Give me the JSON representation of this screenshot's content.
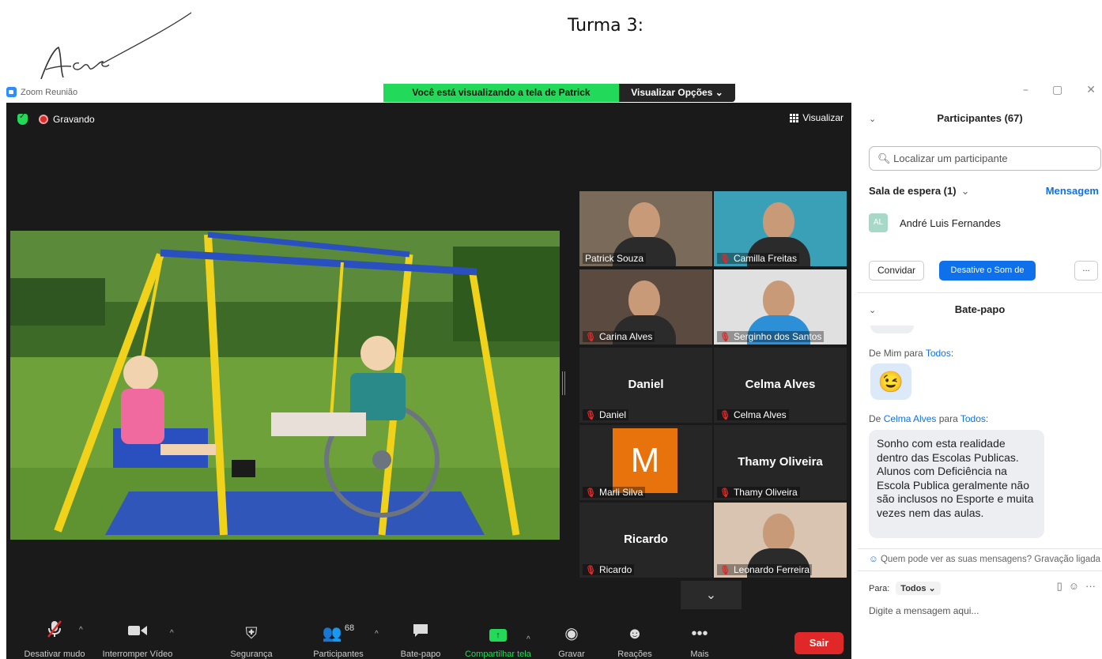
{
  "document": {
    "title": "Turma 3:"
  },
  "window": {
    "title": "Zoom Reunião",
    "share_banner": "Você está visualizando a tela de Patrick Souza",
    "view_options": "Visualizar Opções ⌄",
    "controls": [
      "–",
      "▢",
      "✕"
    ]
  },
  "meeting": {
    "recording_label": "Gravando",
    "view_label": "Visualizar",
    "gallery": [
      {
        "name": "Patrick Souza",
        "muted": false,
        "has_video": true,
        "active": true
      },
      {
        "name": "Camilla Freitas",
        "muted": true,
        "has_video": true
      },
      {
        "name": "Carina Alves",
        "muted": true,
        "has_video": true
      },
      {
        "name": "Serginho dos Santos",
        "muted": true,
        "has_video": true
      },
      {
        "name": "Daniel",
        "muted": true,
        "has_video": false
      },
      {
        "name": "Celma Alves",
        "muted": true,
        "has_video": false
      },
      {
        "name": "Marli Silva",
        "muted": true,
        "has_video": false,
        "avatar_letter": "M"
      },
      {
        "name": "Thamy Oliveira",
        "muted": true,
        "has_video": false
      },
      {
        "name": "Ricardo",
        "muted": true,
        "has_video": false
      },
      {
        "name": "Leonardo Ferreira",
        "muted": true,
        "has_video": true
      }
    ],
    "toolbar": {
      "mute": "Desativar mudo",
      "video": "Interromper Vídeo",
      "security": "Segurança",
      "participants": "Participantes",
      "participants_count": "68",
      "chat": "Bate-papo",
      "share": "Compartilhar tela",
      "record": "Gravar",
      "reactions": "Reações",
      "more": "Mais",
      "leave": "Sair"
    }
  },
  "panel": {
    "participants_title": "Participantes (67)",
    "search_placeholder": "Localizar um participante",
    "waiting_room": "Sala de espera (1)",
    "message_link": "Mensagem",
    "waiting_person": {
      "initials": "AL",
      "name": "André Luis Fernandes"
    },
    "invite": "Convidar",
    "mute_all": "Desative o Som de Todos",
    "more": "...",
    "chat_title": "Bate-papo",
    "messages": [
      {
        "from_prefix": "De ",
        "from": "Mim",
        "to_prefix": " para ",
        "to": "Todos",
        "suffix": ":",
        "emoji": "😉"
      },
      {
        "from_prefix": "De ",
        "from": "Celma Alves",
        "to_prefix": " para ",
        "to": "Todos",
        "suffix": ":",
        "text": "Sonho com esta realidade dentro das Escolas Publicas. Alunos com Deficiência na Escola Publica geralmente não são inclusos no Esporte e muita vezes nem das aulas."
      }
    ],
    "who_sees": "Quem pode ver as suas mensagens? Gravação ligada",
    "to_label": "Para:",
    "to_value": "Todos",
    "compose_placeholder": "Digite a mensagem aqui..."
  },
  "colors": {
    "zoom_blue": "#0e71eb",
    "banner_green": "#23d959",
    "leave_red": "#e02828",
    "active_speaker": "#e8e26a",
    "marli_avatar": "#e8720c"
  }
}
